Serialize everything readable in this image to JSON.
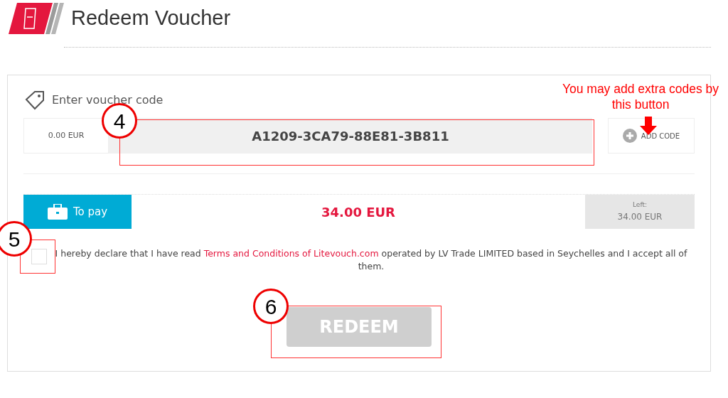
{
  "header": {
    "title": "Redeem Voucher"
  },
  "voucher": {
    "label": "Enter voucher code",
    "amount": "0.00 EUR",
    "code": "A1209-3CA79-88E81-3B811",
    "add_button": "ADD CODE"
  },
  "payment": {
    "label": "To pay",
    "total": "34.00 EUR",
    "left_label": "Left:",
    "left_value": "34.00 EUR"
  },
  "agreement": {
    "checked": false,
    "before": "I hereby declare that I have read ",
    "link": "Terms and Conditions of Litevouch.com",
    "after": " operated by LV Trade LIMITED based in Seychelles and I accept all of them."
  },
  "redeem_button": {
    "label": "REDEEM",
    "disabled": true
  },
  "annotations": [
    {
      "number": "4"
    },
    {
      "number": "5"
    },
    {
      "number": "6"
    }
  ],
  "note": {
    "text": "You may add extra codes by this button"
  }
}
